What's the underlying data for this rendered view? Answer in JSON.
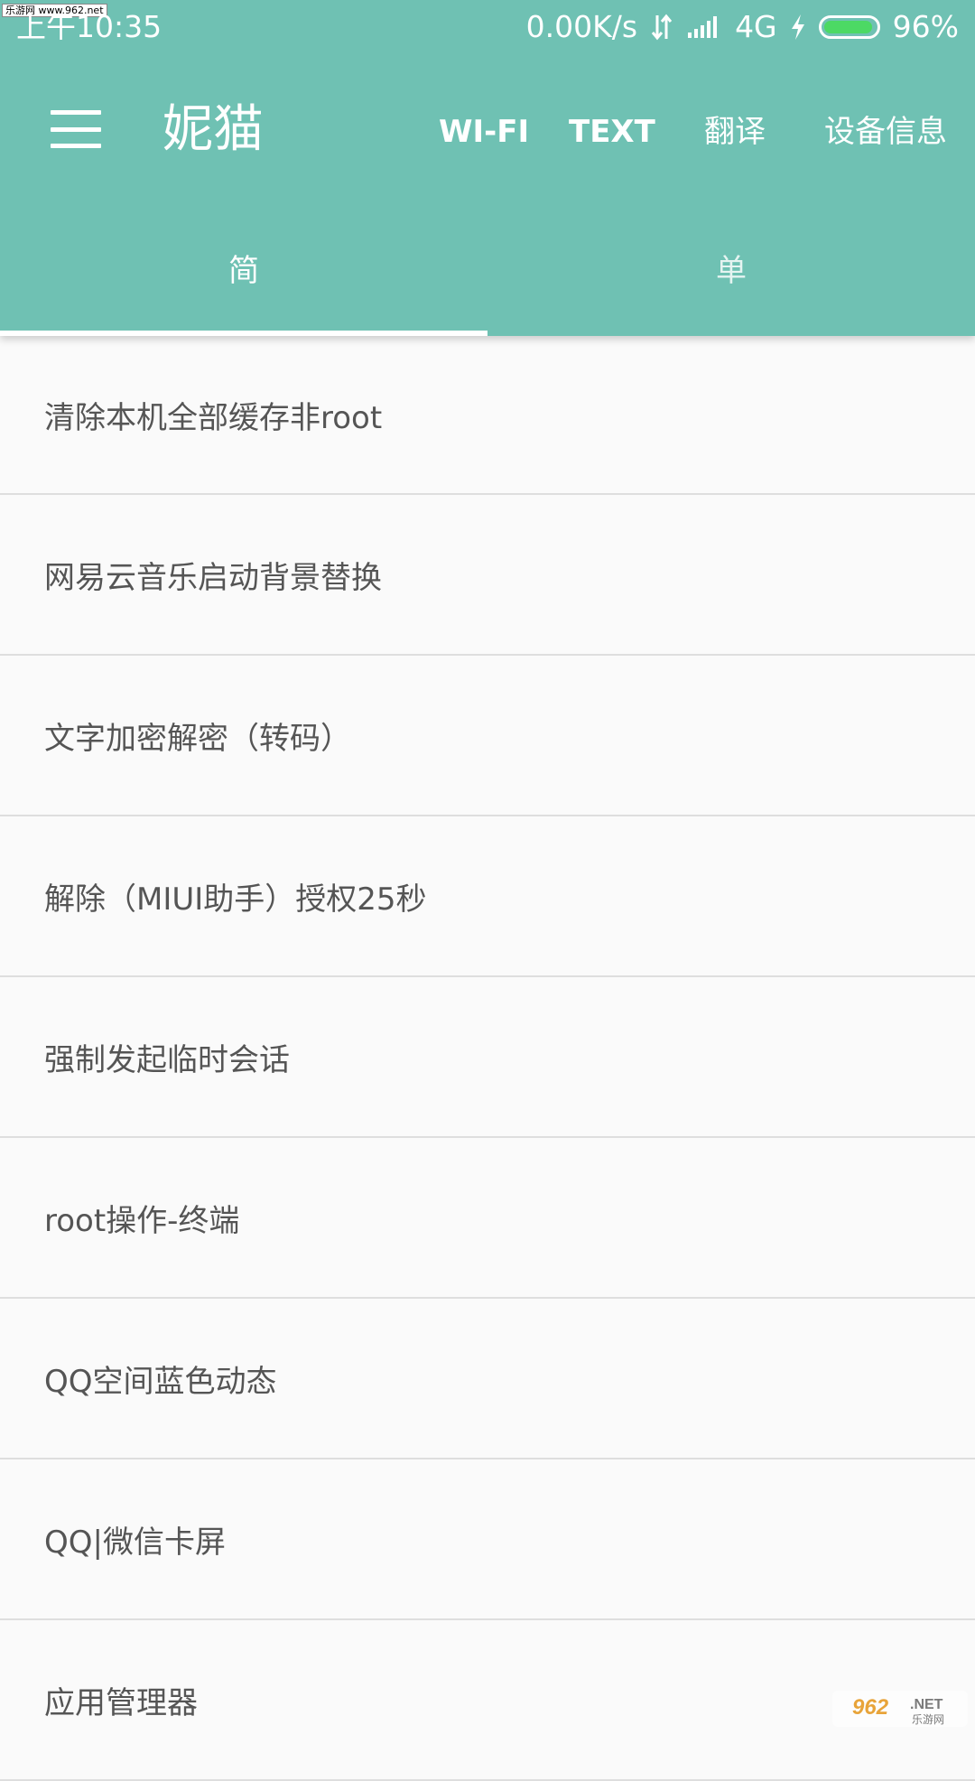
{
  "watermark": {
    "top": "乐游网 www.962.net",
    "bottom_brand": "962",
    "bottom_suffix": ".NET",
    "bottom_cn": "乐游网"
  },
  "status_bar": {
    "time": "上午10:35",
    "speed": "0.00K/s",
    "network": "4G",
    "battery_percent": "96%",
    "battery_level": 0.96
  },
  "toolbar": {
    "title": "妮猫",
    "actions": [
      "WI-FI",
      "TEXT",
      "翻译",
      "设备信息"
    ]
  },
  "tabs": {
    "items": [
      "简",
      "单"
    ],
    "active_index": 0
  },
  "list": {
    "items": [
      "清除本机全部缓存非root",
      "网易云音乐启动背景替换",
      "文字加密解密（转码）",
      "解除（MIUI助手）授权25秒",
      "强制发起临时会话",
      "root操作-终端",
      "QQ空间蓝色动态",
      "QQ|微信卡屏",
      "应用管理器"
    ]
  },
  "colors": {
    "primary": "#6fc1b3",
    "background": "#fafafa",
    "text": "#555555",
    "divider": "#dedede"
  }
}
